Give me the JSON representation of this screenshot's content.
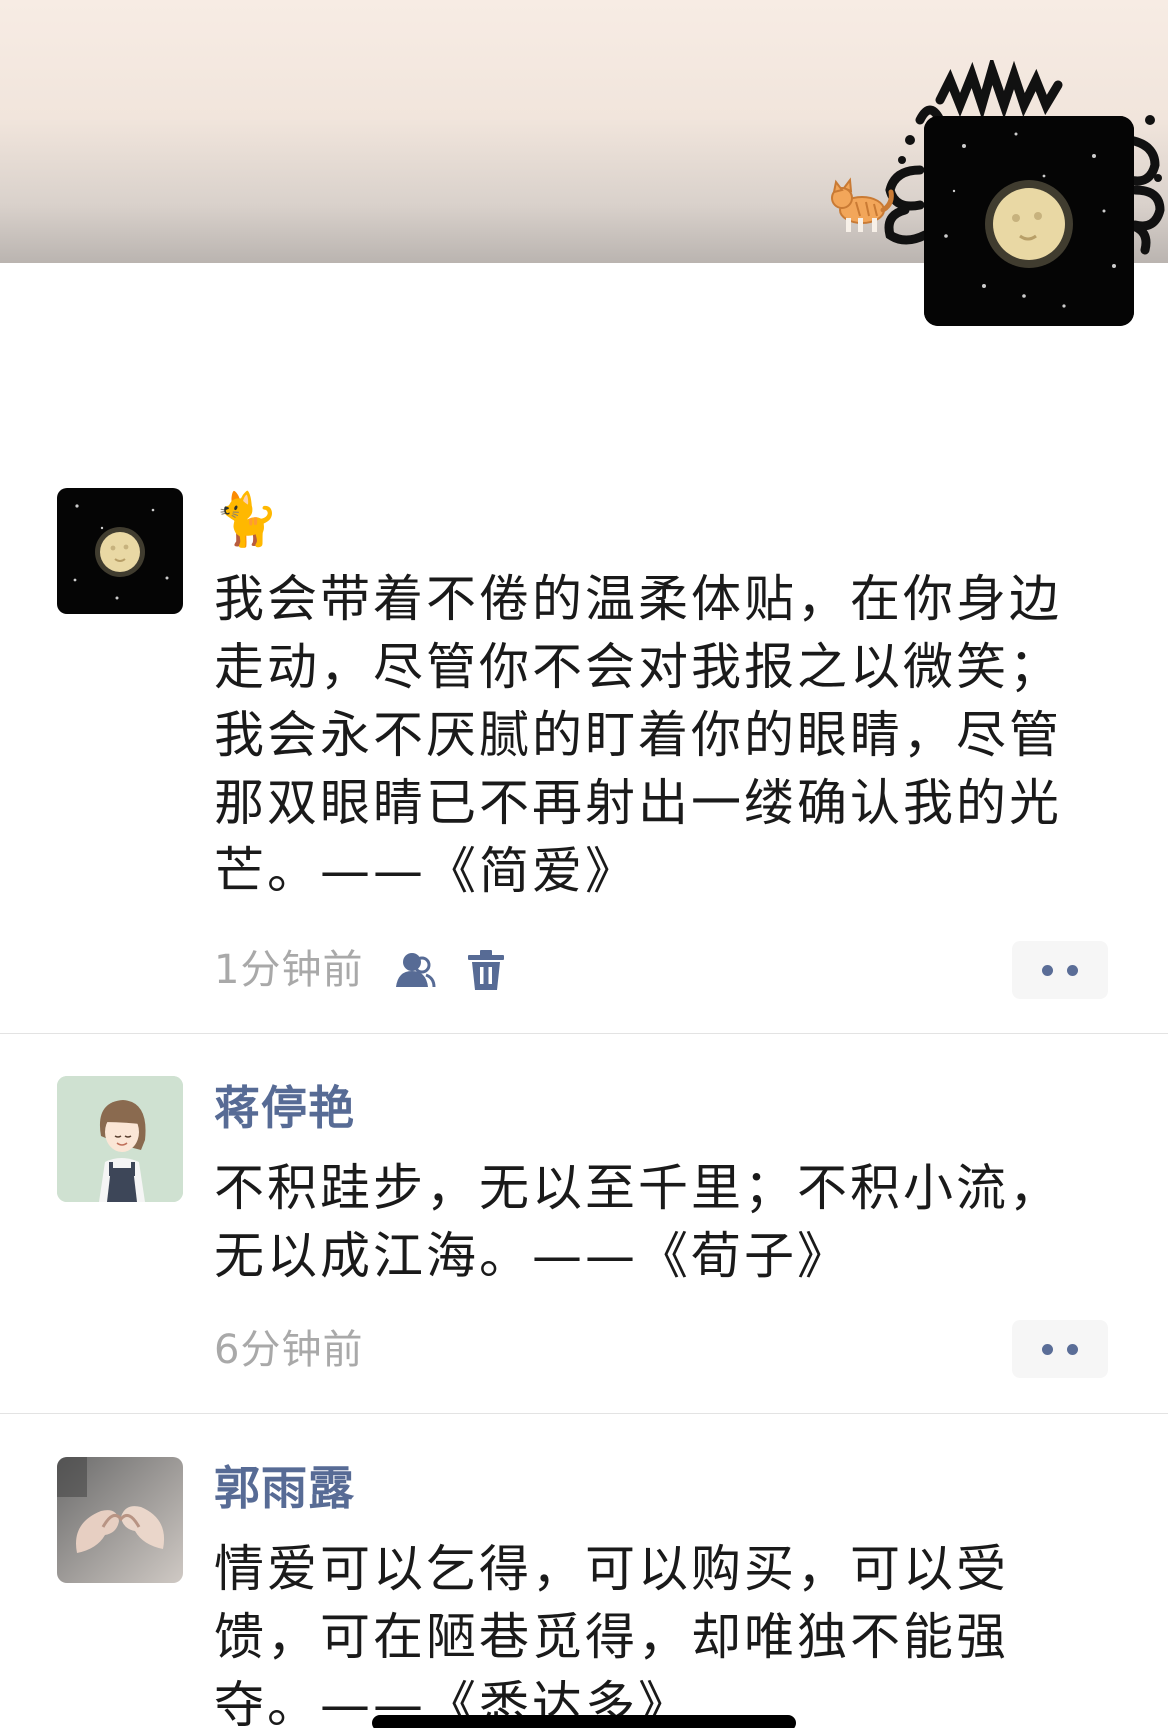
{
  "cover": {
    "cat_emoji": "🐈",
    "profile_avatar_icon": "moon-face-night-sky"
  },
  "posts": [
    {
      "name": "",
      "name_emoji": "🐈",
      "avatar_icon": "moon-face-night-sky",
      "text": "我会带着不倦的温柔体贴，在你身边走动，尽管你不会对我报之以微笑；我会永不厌腻的盯着你的眼睛，尽管那双眼睛已不再射出一缕确认我的光芒。——《简爱》",
      "time": "1分钟前",
      "icons": [
        "friends-visibility-icon",
        "delete-icon"
      ],
      "more_icon": "more-dots-icon"
    },
    {
      "name": "蒋停艳",
      "avatar_icon": "cartoon-girl",
      "text": "不积跬步，无以至千里；不积小流，无以成江海。——《荀子》",
      "time": "6分钟前",
      "more_icon": "more-dots-icon"
    },
    {
      "name": "郭雨露",
      "avatar_icon": "heart-hands-photo",
      "text": "情爱可以乞得，可以购买，可以受馈，可在陋巷觅得，却唯独不能强夺。——《悉达多》"
    }
  ],
  "colors": {
    "name_link": "#576b95",
    "timestamp": "#a9a9a9",
    "body_text": "#1a1a1a"
  }
}
